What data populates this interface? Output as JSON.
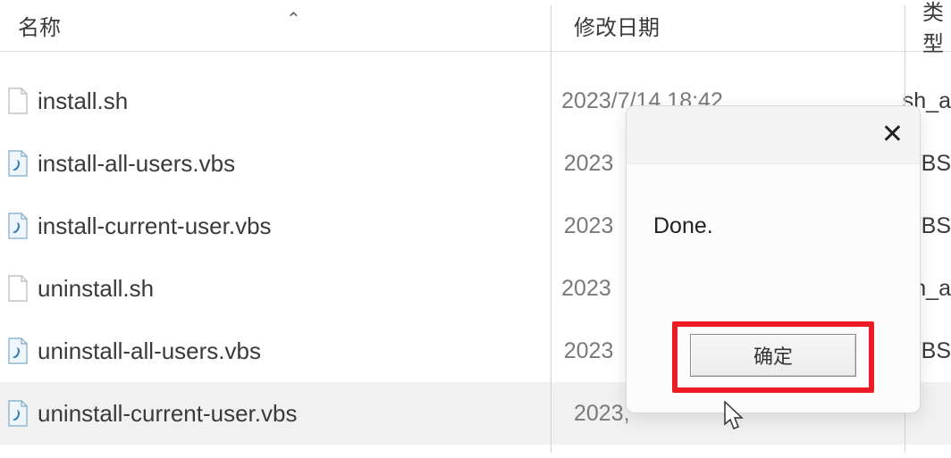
{
  "header": {
    "name_label": "名称",
    "date_label": "修改日期",
    "type_label": "类型"
  },
  "rows": [
    {
      "icon": "file",
      "name": "install.sh",
      "date": "2023/7/14 18:42",
      "type": "sh_a"
    },
    {
      "icon": "vbs",
      "name": "install-all-users.vbs",
      "date": "2023",
      "type": "VBS"
    },
    {
      "icon": "vbs",
      "name": "install-current-user.vbs",
      "date": "2023",
      "type": "VBS"
    },
    {
      "icon": "file",
      "name": "uninstall.sh",
      "date": "2023",
      "type": "sh_a"
    },
    {
      "icon": "vbs",
      "name": "uninstall-all-users.vbs",
      "date": "2023",
      "type": "VBS"
    },
    {
      "icon": "vbs",
      "name": "uninstall-current-user.vbs",
      "date": "2023,",
      "type": ""
    }
  ],
  "dialog": {
    "message": "Done.",
    "ok_label": "确定"
  }
}
